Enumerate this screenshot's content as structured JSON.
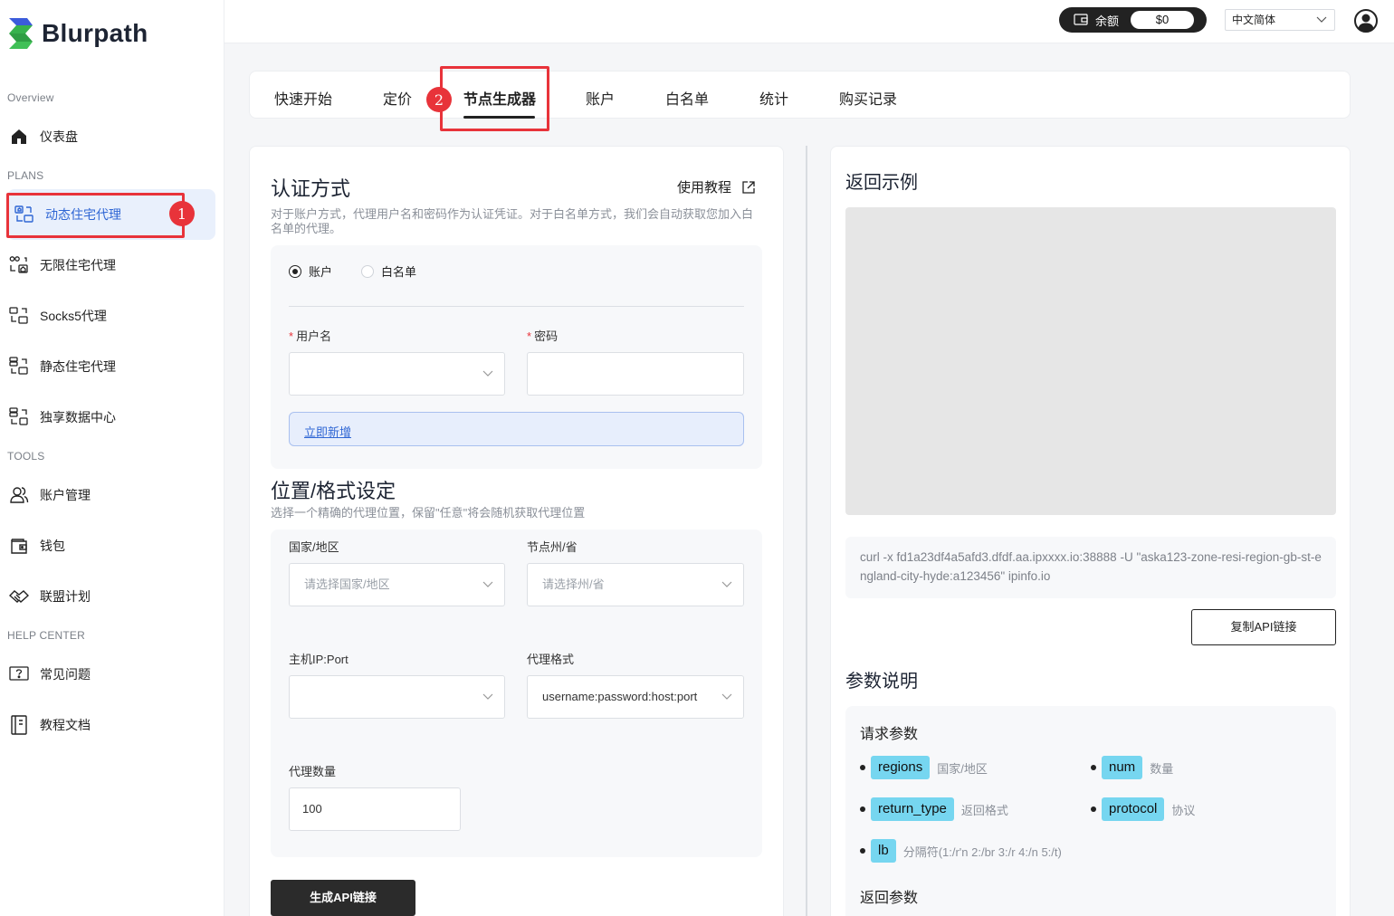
{
  "brand": {
    "name": "Blurpath"
  },
  "sidebar": {
    "sections": {
      "overview": "Overview",
      "plans": "PLANS",
      "tools": "TOOLS",
      "help": "HELP CENTER"
    },
    "items": [
      {
        "label": "仪表盘",
        "icon": "home-icon"
      },
      {
        "label": "动态住宅代理",
        "icon": "residential-proxy-icon",
        "active": true
      },
      {
        "label": "无限住宅代理",
        "icon": "unlimited-proxy-icon"
      },
      {
        "label": "Socks5代理",
        "icon": "socks5-icon"
      },
      {
        "label": "静态住宅代理",
        "icon": "static-proxy-icon"
      },
      {
        "label": "独享数据中心",
        "icon": "datacenter-icon"
      },
      {
        "label": "账户管理",
        "icon": "users-icon"
      },
      {
        "label": "钱包",
        "icon": "wallet-icon"
      },
      {
        "label": "联盟计划",
        "icon": "affiliate-icon"
      },
      {
        "label": "常见问题",
        "icon": "faq-icon"
      },
      {
        "label": "教程文档",
        "icon": "docs-icon"
      }
    ]
  },
  "annotations": {
    "badge1": "1",
    "badge2": "2",
    "color": "#e8333a"
  },
  "topbar": {
    "balance_label": "余额",
    "balance_value": "$0",
    "language": "中文简体"
  },
  "tabs": [
    {
      "label": "快速开始"
    },
    {
      "label": "定价"
    },
    {
      "label": "节点生成器",
      "active": true
    },
    {
      "label": "账户"
    },
    {
      "label": "白名单"
    },
    {
      "label": "统计"
    },
    {
      "label": "购买记录"
    }
  ],
  "auth": {
    "title": "认证方式",
    "tutorial_link": "使用教程",
    "description": "对于账户方式，代理用户名和密码作为认证凭证。对于白名单方式，我们会自动获取您加入白名单的代理。",
    "radio_account": "账户",
    "radio_whitelist": "白名单",
    "username_label": "用户名",
    "password_label": "密码",
    "add_now": "立即新增"
  },
  "location": {
    "title": "位置/格式设定",
    "description": "选择一个精确的代理位置，保留\"任意\"将会随机获取代理位置",
    "country_label": "国家/地区",
    "country_placeholder": "请选择国家/地区",
    "state_label": "节点州/省",
    "state_placeholder": "请选择州/省",
    "host_label": "主机IP:Port",
    "format_label": "代理格式",
    "format_value": "username:password:host:port",
    "quantity_label": "代理数量",
    "quantity_value": "100",
    "generate_button": "生成API链接"
  },
  "example": {
    "title": "返回示例",
    "curl": "curl -x fd1a23df4a5afd3.dfdf.aa.ipxxxx.io:38888 -U \"aska123-zone-resi-region-gb-st-england-city-hyde:a123456\" ipinfo.io",
    "copy_button": "复制API链接"
  },
  "params": {
    "title": "参数说明",
    "request_title": "请求参数",
    "return_title": "返回参数",
    "items": [
      {
        "name": "regions",
        "desc": "国家/地区"
      },
      {
        "name": "num",
        "desc": "数量"
      },
      {
        "name": "return_type",
        "desc": "返回格式"
      },
      {
        "name": "protocol",
        "desc": "协议"
      },
      {
        "name": "lb",
        "desc": "分隔符(1:/r'n 2:/br 3:/r 4:/n 5:/t)"
      }
    ],
    "chip_color": "#76d6f0"
  }
}
